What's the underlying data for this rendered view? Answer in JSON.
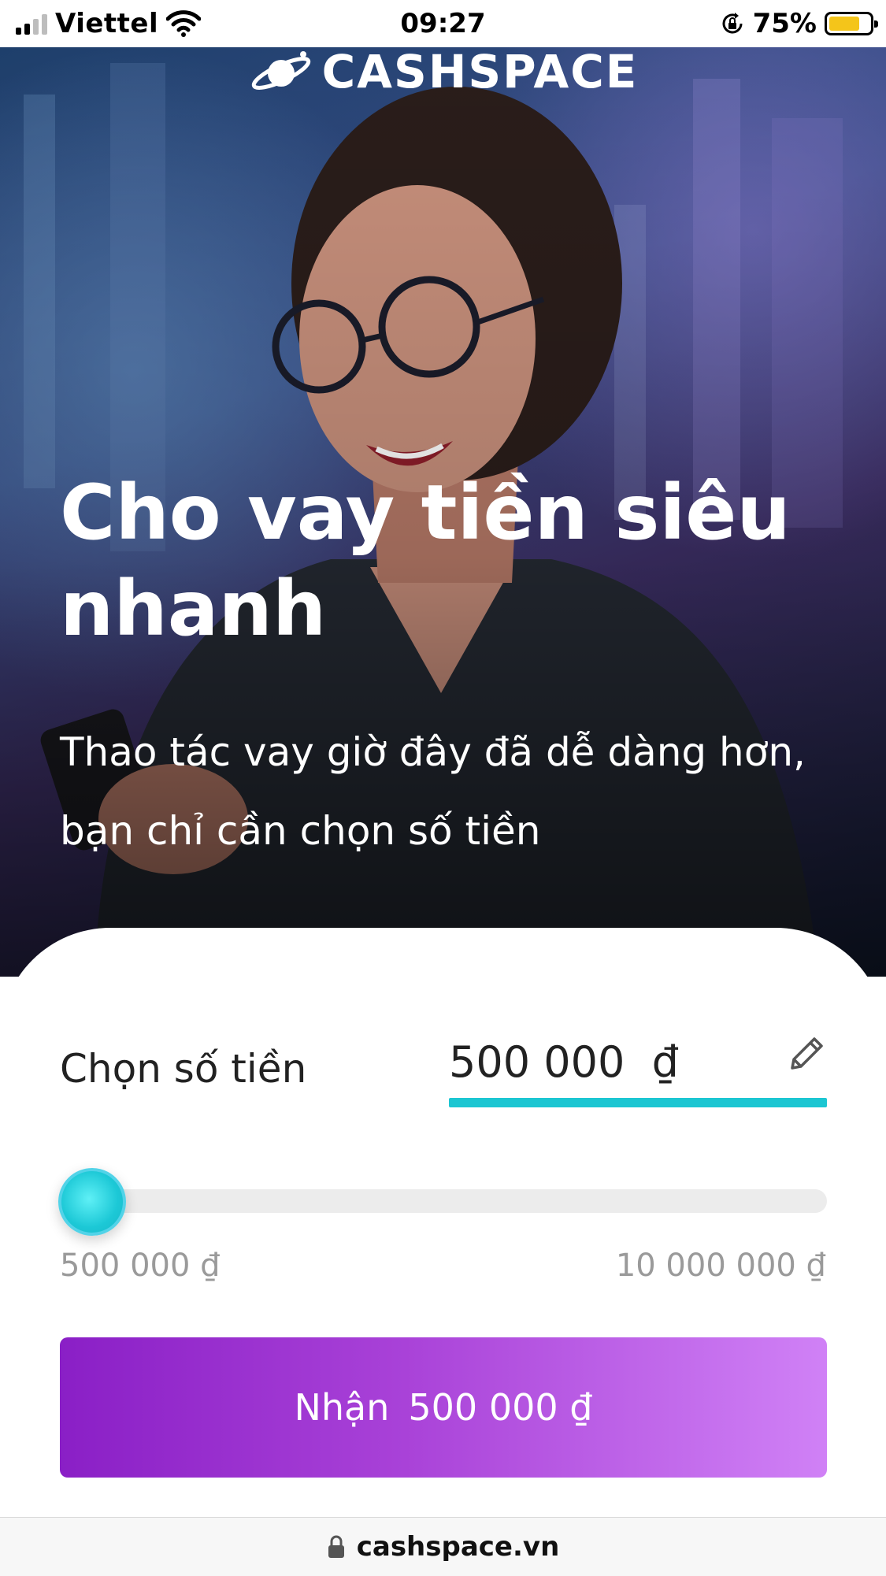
{
  "status_bar": {
    "carrier": "Viettel",
    "time": "09:27",
    "battery_percent": "75%",
    "battery_level": 0.75
  },
  "brand": {
    "name": "CASHSPACE"
  },
  "hero": {
    "title": "Cho vay tiền siêu nhanh",
    "subtitle": "Thao tác vay giờ đây đã dễ dàng hơn, bạn chỉ cần chọn số tiền"
  },
  "loan": {
    "choose_label": "Chọn số tiền",
    "amount_value": "500 000  ₫",
    "slider_fraction": 0.0,
    "min_label": "500 000 ₫",
    "max_label": "10 000 000 ₫"
  },
  "cta": {
    "label": "Nhận",
    "amount": "500 000 ₫"
  },
  "browser": {
    "url": "cashspace.vn"
  },
  "colors": {
    "accent_teal": "#1cc6d2",
    "cta_start": "#8a1fc6",
    "cta_end": "#d081f6",
    "battery": "#f4c51a"
  },
  "icons": [
    "signal-icon",
    "wifi-icon",
    "rotation-lock-icon",
    "battery-icon",
    "planet-logo-icon",
    "pencil-icon",
    "lock-icon"
  ]
}
